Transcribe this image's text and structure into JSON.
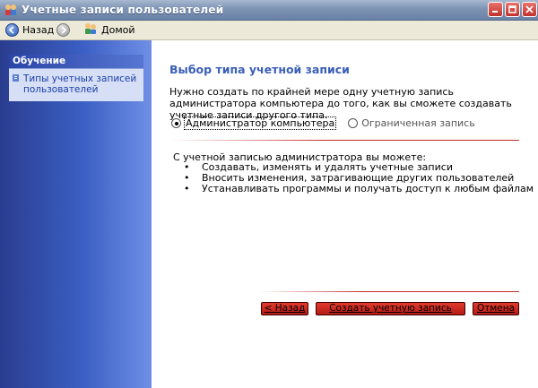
{
  "window": {
    "title": "Учетные записи пользователей",
    "icon": "users-icon",
    "controls": [
      "minimize-icon",
      "maximize-icon",
      "close-icon"
    ]
  },
  "toolbar": {
    "back_label": "Назад",
    "home_label": "Домой"
  },
  "sidebar": {
    "panel_title": "Обучение",
    "link_label": "Типы учетных записей пользователей"
  },
  "main": {
    "title": "Выбор типа учетной записи",
    "intro": "Нужно создать по крайней мере одну учетную запись администратора компьютера до того, как вы сможете создавать учетные записи другого типа.",
    "options": [
      {
        "label": "Администратор компьютера",
        "checked": true
      },
      {
        "label": "Ограниченная запись",
        "checked": false
      }
    ],
    "description": "С учетной записью администратора вы можете:",
    "bullets": [
      "Создавать, изменять и удалять учетные записи",
      "Вносить изменения, затрагивающие других пользователей",
      "Устанавливать программы и получать доступ к любым файлам"
    ],
    "bullet_char": "•"
  },
  "buttons": {
    "back": "< Назад",
    "create": "Создать учетную запись",
    "cancel": "Отмена"
  },
  "colors": {
    "accent_title": "#3a5fb8",
    "button_red": "#c22a2a",
    "sidebar_blue": "#3b5fc4"
  }
}
